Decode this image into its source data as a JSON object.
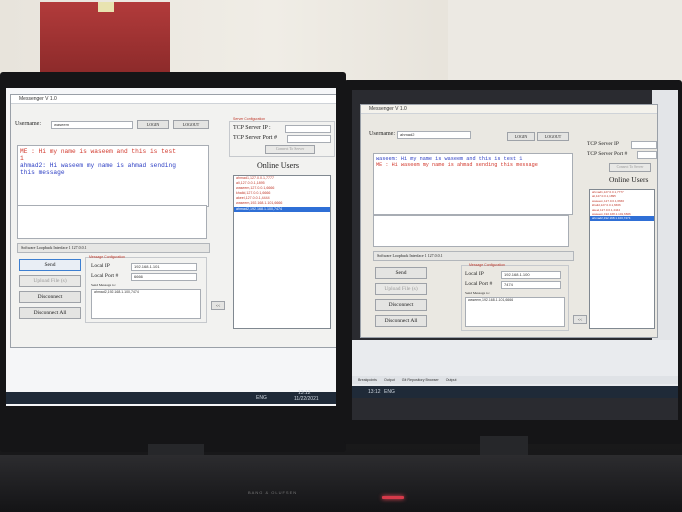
{
  "left_app": {
    "title": "Messenger V 1.0",
    "username_label": "Username:",
    "username_value": "waseem",
    "login_label": "LOGIN",
    "logout_label": "LOGOUT",
    "server_group_label": "Server Configuration",
    "tcp_ip_label": "TCP Server IP :",
    "tcp_port_label": "TCP Server Port #",
    "connect_label": "Connect To Server",
    "online_title": "Online Users",
    "online_users": [
      "ahmad1,127.0.0.1,7777",
      "ali,127.0.0.1,1895",
      "waseem,127.0.0.1,6666",
      "khalid,127.0.0.1,6666",
      "akeel,127.0.0.1,4444",
      "waseem,192.168.1.101,6666",
      "ahmad2,192.168.1.100,7474"
    ],
    "selected_user": "ahmad2,192.168.1.100,7474",
    "chat_lines": [
      {
        "text": "ME : Hi my name is waseem and this is test",
        "color": "#d23a2e"
      },
      {
        "text": "1",
        "color": "#d23a2e"
      },
      {
        "text": "ahmad2: Hi waseem my name is ahmad sending",
        "color": "#2d3fc4"
      },
      {
        "text": "this message",
        "color": "#2d3fc4"
      }
    ],
    "interface_value": "Software Loopback Interface 1 127.0.0.1",
    "send_label": "Send",
    "upload_label": "Upload File (s)",
    "disconnect_label": "Disconnect",
    "disconnect_all_label": "Disconnect All",
    "msg_group_label": "Message Configuration",
    "local_ip_label": "Local IP",
    "local_ip_value": "192.168.1.101",
    "local_port_label": "Local Port #",
    "local_port_value": "6666",
    "send_msg_to_label": "Send Message to:",
    "send_msg_to_value": "ahmad2,192.168.1.100,7474",
    "arrow_label": "<<",
    "clock_time": "13:12",
    "clock_date": "11/22/2021",
    "lang": "ENG"
  },
  "right_app": {
    "title": "Messenger V 1.0",
    "username_label": "Username:",
    "username_value": "ahmad2",
    "login_label": "LOGIN",
    "logout_label": "LOGOUT",
    "tcp_ip_label": "TCP Server IP",
    "tcp_port_label": "TCP Server Port #",
    "connect_label": "Connect To Server",
    "online_title": "Online Users",
    "online_users": [
      "ahmad1,127.0.0.1,7777",
      "ali,127.0.0.1,1895",
      "waseem,127.0.0.1,6666",
      "khalid,127.0.0.1,6666",
      "akeel,127.0.0.1,4444",
      "waseem,192.168.1.101,6666",
      "ahmad2,192.168.1.100,7474"
    ],
    "selected_user": "ahmad2,192.168.1.100,7474",
    "chat_lines": [
      {
        "text": "waseem: Hi my name is waseem and this is test 1",
        "color": "#2d3fc4"
      },
      {
        "text": "ME : Hi waseem my name is ahmad sending this message",
        "color": "#d23a2e"
      }
    ],
    "interface_value": "Software Loopback Interface 1 127.0.0.1",
    "send_label": "Send",
    "upload_label": "Upload File (s)",
    "disconnect_label": "Disconnect",
    "disconnect_all_label": "Disconnect All",
    "msg_group_label": "Message Configuration",
    "local_ip_label": "Local IP",
    "local_ip_value": "192.168.1.100",
    "local_port_label": "Local Port #",
    "local_port_value": "7474",
    "send_msg_to_label": "Send Message to:",
    "send_msg_to_value": "waseem,192.168.1.101,6666",
    "arrow_label": "<<",
    "clock_time": "13:12",
    "lang": "ENG",
    "ide_tabs": [
      "Breakpoints",
      "Output",
      "Git Repository Browser",
      "Output"
    ]
  },
  "colors": {
    "select": "#2f6fd6",
    "me_text": "#d23a2e",
    "peer_text": "#2d3fc4",
    "led": "#d63a4a"
  },
  "brand": "BANG & OLUFSEN"
}
